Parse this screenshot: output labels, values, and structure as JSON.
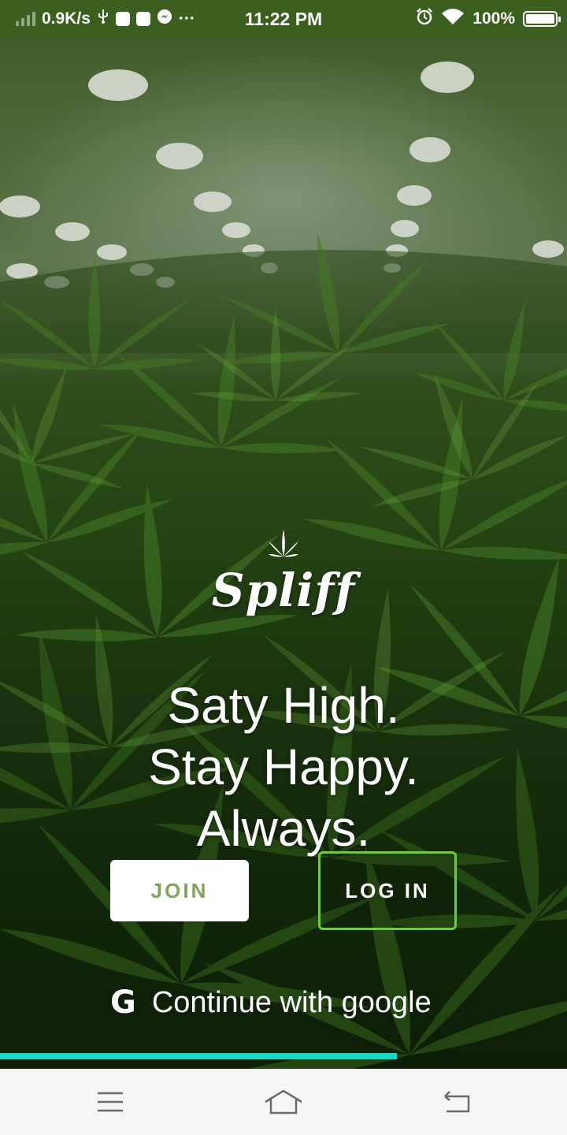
{
  "status_bar": {
    "speed": "0.9K/s",
    "time": "11:22 PM",
    "battery": "100%",
    "icons": [
      "signal-icon",
      "usb-icon",
      "tb-icon",
      "mail-icon",
      "messenger-icon",
      "more-icon",
      "alarm-icon",
      "wifi-icon",
      "battery-icon"
    ],
    "more": "···"
  },
  "hero": {
    "logo_text": "Spliff",
    "tagline": [
      "Saty High.",
      "Stay Happy.",
      "Always."
    ]
  },
  "actions": {
    "join_label": "JOIN",
    "login_label": "LOG IN",
    "google_label": "Continue with google",
    "google_glyph": "G"
  },
  "progress": {
    "value": 0.7
  },
  "colors": {
    "status_bar": "#3a5f1e",
    "join_text": "#7fa55b",
    "login_border": "#6ccd34",
    "progress": "#18d6c5",
    "nav_bg": "#f6f6f6"
  }
}
